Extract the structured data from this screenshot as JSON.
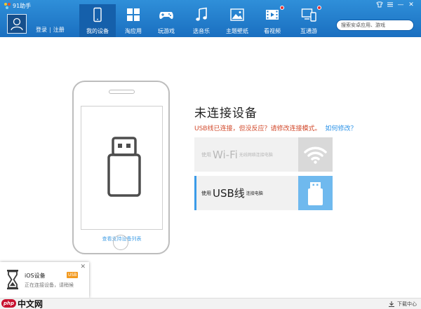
{
  "app": {
    "title": "91助手"
  },
  "colors": {
    "topbar": "#1f7ccc",
    "accent": "#3b9be8",
    "warning": "#d2492b",
    "link": "#2c93e8",
    "badge": "#f39a1f"
  },
  "window_controls": [
    {
      "name": "skin-icon"
    },
    {
      "name": "menu-icon"
    },
    {
      "name": "minimize-icon",
      "glyph": "—"
    },
    {
      "name": "close-icon",
      "glyph": "✕"
    }
  ],
  "user": {
    "login": "登录",
    "separator": "|",
    "register": "注册"
  },
  "nav": [
    {
      "id": "my-devices",
      "label": "我的设备",
      "icon": "phone-icon",
      "active": true
    },
    {
      "id": "apps",
      "label": "淘应用",
      "icon": "grid-icon"
    },
    {
      "id": "games",
      "label": "玩游戏",
      "icon": "gamepad-icon"
    },
    {
      "id": "music",
      "label": "选音乐",
      "icon": "music-note-icon"
    },
    {
      "id": "wallpaper",
      "label": "主题壁纸",
      "icon": "picture-icon"
    },
    {
      "id": "video",
      "label": "看视频",
      "icon": "film-icon",
      "notify": true
    },
    {
      "id": "interconnect",
      "label": "互通游",
      "icon": "devices-icon",
      "notify": true
    }
  ],
  "search": {
    "placeholder": "搜索安卓应用、游戏"
  },
  "device": {
    "support_link": "查看支持设备列表",
    "headline": "未连接设备",
    "warning": "USB线已连接，但没反应？请修改连接模式。",
    "how_link": "如何修改？"
  },
  "connections": {
    "wifi": {
      "prefix": "使用",
      "main": "Wi-Fi",
      "suffix": "无线网络连接电脑",
      "icon": "wifi-icon"
    },
    "usb": {
      "prefix": "使用",
      "main": "USB线",
      "suffix": "连接电脑",
      "icon": "usb-icon"
    }
  },
  "popup": {
    "title": "iOS设备",
    "badge": "USB",
    "subtitle": "正在连接设备，请稍候",
    "icon": "hourglass-icon"
  },
  "status": {
    "download_center": "下载中心"
  },
  "watermark": {
    "php": "php",
    "cn": "中文网"
  }
}
